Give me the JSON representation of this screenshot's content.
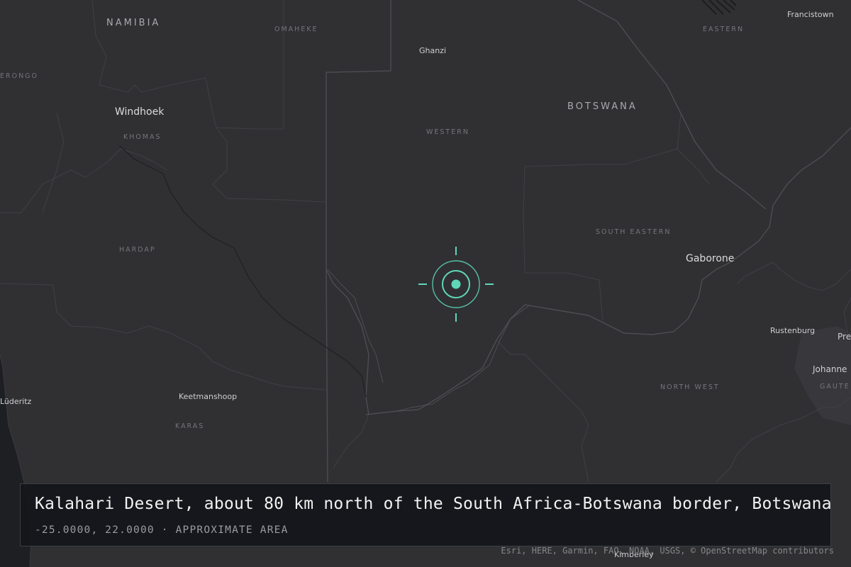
{
  "map": {
    "countries": [
      {
        "name": "NAMIBIA"
      },
      {
        "name": "BOTSWANA"
      }
    ],
    "regions": [
      {
        "name": "OMAHEKE"
      },
      {
        "name": "EASTERN"
      },
      {
        "name": "ERONGO"
      },
      {
        "name": "KHOMAS"
      },
      {
        "name": "WESTERN"
      },
      {
        "name": "SOUTH EASTERN"
      },
      {
        "name": "HARDAP"
      },
      {
        "name": "NORTH WEST"
      },
      {
        "name": "KARAS"
      },
      {
        "name": "GAUTE"
      }
    ],
    "cities": [
      {
        "name": "Francistown"
      },
      {
        "name": "Ghanzi"
      },
      {
        "name": "Windhoek"
      },
      {
        "name": "Gaborone"
      },
      {
        "name": "Rustenburg"
      },
      {
        "name": "Pre"
      },
      {
        "name": "Johanne"
      },
      {
        "name": "Keetmanshoop"
      },
      {
        "name": "Lüderitz"
      },
      {
        "name": "Kimberley"
      }
    ]
  },
  "marker": {
    "icon": "location-target-icon",
    "color": "#5fd8b8"
  },
  "caption": {
    "title": "Kalahari Desert, about 80 km north of the South Africa-Botswana border, Botswana",
    "coordinates": "-25.0000, 22.0000",
    "separator": "·",
    "precision": "APPROXIMATE AREA"
  },
  "attribution": "Esri, HERE, Garmin, FAO, NOAA, USGS, © OpenStreetMap contributors"
}
